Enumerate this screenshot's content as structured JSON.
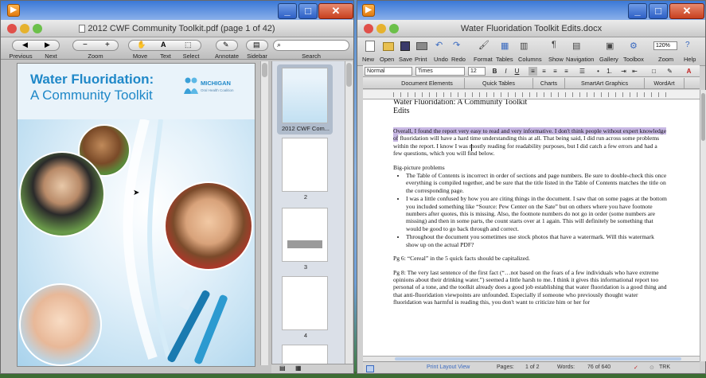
{
  "pdf_window": {
    "title": "2012 CWF Community Toolkit.pdf (page 1 of 42)",
    "toolbar": [
      {
        "id": "previous",
        "label": "Previous"
      },
      {
        "id": "next",
        "label": "Next"
      },
      {
        "id": "zoom",
        "label": "Zoom"
      },
      {
        "id": "move",
        "label": "Move"
      },
      {
        "id": "text",
        "label": "Text"
      },
      {
        "id": "select",
        "label": "Select"
      },
      {
        "id": "annotate",
        "label": "Annotate"
      },
      {
        "id": "sidebar",
        "label": "Sidebar"
      },
      {
        "id": "search",
        "label": "Search"
      }
    ],
    "page": {
      "title_line1": "Water Fluoridation:",
      "title_line2": "A Community Toolkit",
      "logo_text": "MICHIGAN",
      "logo_sub": "Oral Health Coalition"
    },
    "thumbnails": [
      {
        "label": "2012 CWF Com..."
      },
      {
        "label": "2"
      },
      {
        "label": "3"
      },
      {
        "label": "4"
      }
    ]
  },
  "word_window": {
    "title": "Water Fluoridation Toolkit Edits.docx",
    "toolbar": [
      "New",
      "Open",
      "Save",
      "Print",
      "Undo",
      "Redo",
      "Format",
      "Tables",
      "Columns",
      "Show",
      "Navigation",
      "Gallery",
      "Toolbox",
      "Zoom",
      "Help"
    ],
    "zoom_value": "120%",
    "style_value": "Normal",
    "font_value": "Times",
    "size_value": "12",
    "ribbon_tabs": [
      "Document Elements",
      "Quick Tables",
      "Charts",
      "SmartArt Graphics",
      "WordArt"
    ],
    "doc": {
      "heading_line1": "Water Fluoridation: A Community Toolkit",
      "heading_line2": "Edits",
      "para1_highlight": "Overall, I found the report very easy to read and very informative. I don't think people without expert knowledge of",
      "para1_rest": " fluoridation will have a hard time understanding this at all. That being said, I did run across some problems within the report. I know I was mostly reading for readability purposes, but I did catch a few errors and had a few questions, which you will find below.",
      "big_picture": "Big-picture problems",
      "bullets": [
        "The Table of Contents is incorrect in order of sections and page numbers. Be sure to double-check this once everything is compiled together, and be sure that the title listed in the Table of Contents matches the title on the corresponding page.",
        "I was a little confused by how you are citing things in the document. I saw that on some pages at the bottom you included something like “Source: Pew Center on the Sate” but on others where you have footnote numbers after quotes, this is missing. Also, the footnote numbers do not go in order (some numbers are missing) and then in some parts, the count starts over at 1 again. This will definitely be something that would be good to go back through and correct.",
        "Throughout the document you sometimes use stock photos that have a watermark. Will this watermark show up on the actual PDF?"
      ],
      "pg6": "Pg 6: “Cereal” in the 5 quick facts should be capitalized.",
      "pg8": "Pg 8: The very last sentence of the first fact (“…not based on the fears of a few individuals who have extreme opinions about their drinking water.”) seemed a little harsh to me. I think it gives this informational report too personal of a tone, and the toolkit already does a good job establishing that water fluoridation is a good thing and that anti-fluoridation viewpoints are unfounded. Especially if someone who previously thought water fluoridation was harmful is reading this, you don't want to criticize him or her for"
    },
    "status": {
      "view": "Print Layout View",
      "pages_label": "Pages:",
      "pages_value": "1 of 2",
      "words_label": "Words:",
      "words_value": "76 of 640",
      "trk": "TRK"
    }
  },
  "colors": {
    "pdf_cover_blue": "#1f88c8",
    "highlight": "#c8b8e4",
    "xp_close": "#c8401f"
  }
}
